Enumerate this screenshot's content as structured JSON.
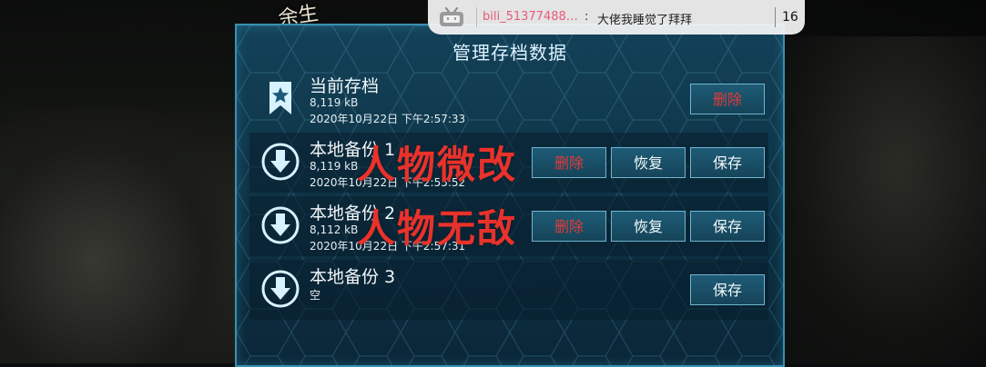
{
  "logo": {
    "text": "余生"
  },
  "panel": {
    "title": "管理存档数据"
  },
  "rows": [
    {
      "name": "当前存档",
      "size": "8,119 kB",
      "date": "2020年10月22日 下午2:57:33",
      "icon": "bookmark-star-icon",
      "delete_label": "删除"
    },
    {
      "name": "本地备份 1",
      "size": "8,119 kB",
      "date": "2020年10月22日 下午2:55:52",
      "icon": "download-arrow-icon",
      "delete_label": "删除",
      "restore_label": "恢复",
      "save_label": "保存"
    },
    {
      "name": "本地备份 2",
      "size": "8,112 kB",
      "date": "2020年10月22日 下午2:57:31",
      "icon": "download-arrow-icon",
      "delete_label": "删除",
      "restore_label": "恢复",
      "save_label": "保存"
    },
    {
      "name": "本地备份 3",
      "size": "空",
      "icon": "download-arrow-icon",
      "save_label": "保存"
    }
  ],
  "overlay": {
    "line1": "人物微改",
    "line2": "人物无敌"
  },
  "danmaku": {
    "user": "bili_51377488…",
    "colon": ":",
    "message": "大佬我睡觉了拜拜",
    "count": "16"
  },
  "colors": {
    "accent": "#3a8fb0",
    "delete": "#e23b3b",
    "overlay": "#e8322b",
    "username": "#e85a7a"
  }
}
